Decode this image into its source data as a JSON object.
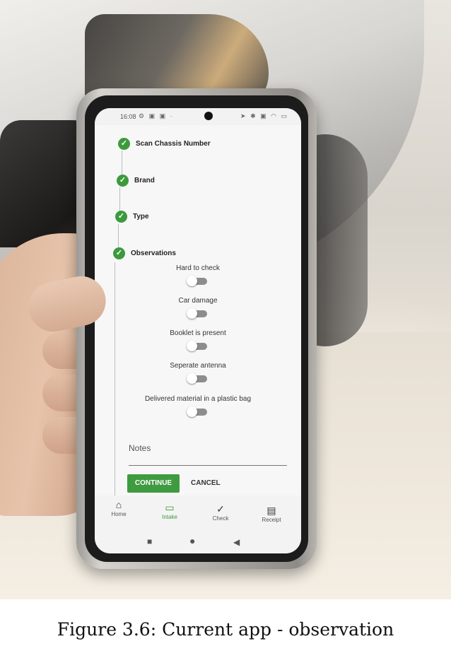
{
  "status_bar": {
    "time": "16:08",
    "left_icons": "⚙ ▣ ▣ ·",
    "right_icons": "➤ ✱ ▣ ◠ ▭"
  },
  "steps": [
    {
      "label": "Scan Chassis Number",
      "done": true
    },
    {
      "label": "Brand",
      "done": true
    },
    {
      "label": "Type",
      "done": true
    },
    {
      "label": "Observations",
      "done": true
    }
  ],
  "observations": [
    {
      "label": "Hard to check",
      "on": false
    },
    {
      "label": "Car damage",
      "on": false
    },
    {
      "label": "Booklet is present",
      "on": false
    },
    {
      "label": "Seperate antenna",
      "on": false
    },
    {
      "label": "Delivered material in a plastic bag",
      "on": false
    }
  ],
  "notes": {
    "label": "Notes",
    "value": ""
  },
  "buttons": {
    "continue": "CONTINUE",
    "cancel": "CANCEL"
  },
  "bottom_nav": [
    {
      "label": "Home",
      "icon": "home-icon",
      "glyph": "⌂",
      "active": false
    },
    {
      "label": "Intake",
      "icon": "inbox-icon",
      "glyph": "▭",
      "active": true
    },
    {
      "label": "Check",
      "icon": "check-icon",
      "glyph": "✓",
      "active": false
    },
    {
      "label": "Receipt",
      "icon": "receipt-icon",
      "glyph": "▤",
      "active": false
    }
  ],
  "system_nav": {
    "recents": "■",
    "home": "●",
    "back": "◀"
  },
  "colors": {
    "accent": "#3c9a3c"
  },
  "caption": "Figure 3.6: Current app - observation"
}
